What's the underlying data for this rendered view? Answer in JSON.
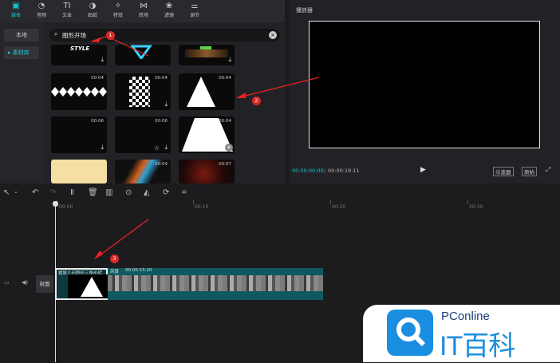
{
  "toolbar": {
    "tools": [
      {
        "icon": "media-icon",
        "label": "媒体"
      },
      {
        "icon": "audio-icon",
        "label": "音频"
      },
      {
        "icon": "text-icon",
        "label": "文本"
      },
      {
        "icon": "sticker-icon",
        "label": "贴纸"
      },
      {
        "icon": "effects-icon",
        "label": "特效"
      },
      {
        "icon": "transition-icon",
        "label": "转场"
      },
      {
        "icon": "filter-icon",
        "label": "滤镜"
      },
      {
        "icon": "adjust-icon",
        "label": "调节"
      }
    ]
  },
  "sidebar": {
    "local": "本地",
    "library": "素材库"
  },
  "search": {
    "value": "图形开场"
  },
  "grid": {
    "items": [
      {
        "text": "STYLE",
        "duration": ""
      },
      {
        "duration": ""
      },
      {
        "duration": ""
      },
      {
        "duration": "00:04"
      },
      {
        "duration": "00:04"
      },
      {
        "duration": "00:04"
      },
      {
        "duration": "00:06"
      },
      {
        "duration": "00:06"
      },
      {
        "duration": "00:04"
      },
      {
        "duration": ""
      },
      {
        "duration": "00:04"
      },
      {
        "duration": "00:07"
      }
    ]
  },
  "player": {
    "title": "播放器",
    "current_time": "00:00:00:00",
    "total_time": "00:00:19:11",
    "btn_left": "示波器",
    "btn_right": "原始"
  },
  "ruler": {
    "t0": "00:00",
    "t1": "00:10",
    "t2": "00:20",
    "t3": "00:30"
  },
  "timeline": {
    "cover": "封面",
    "clip1_label": "横屏几何图形三角形转",
    "clip2_label": "风景",
    "clip2_time": "00:00:15:20"
  },
  "annotations": {
    "n1": "1",
    "n2": "2",
    "n3": "3"
  },
  "watermark": {
    "brand": "PConline",
    "product": "IT百科"
  }
}
